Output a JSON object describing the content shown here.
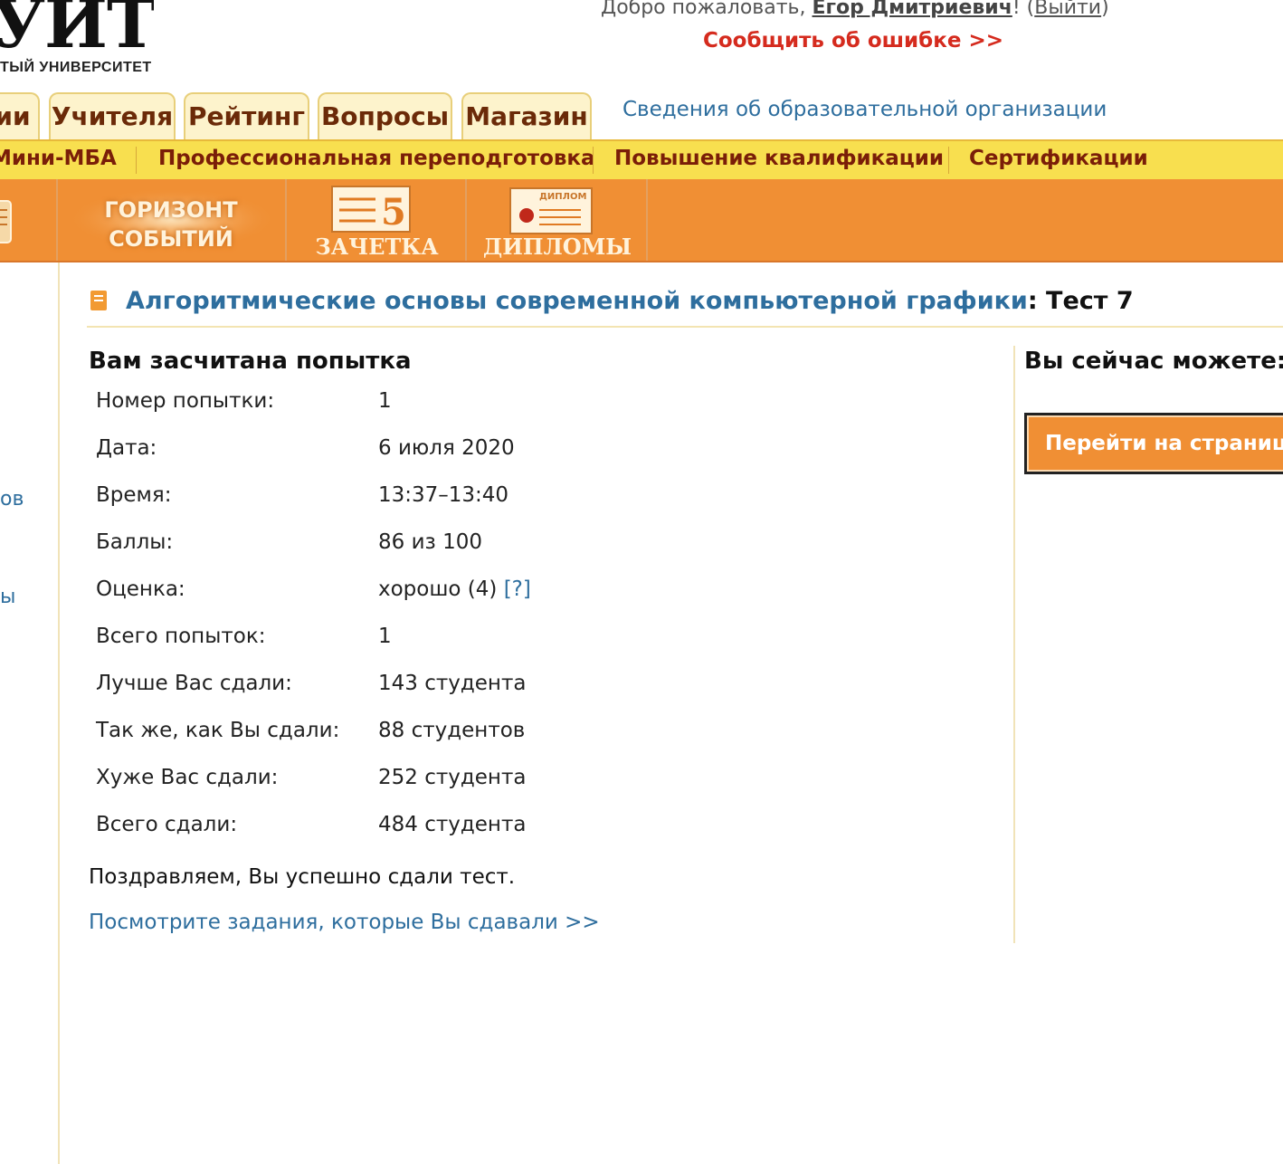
{
  "logo": {
    "big": "УИТ",
    "small": "ТЫЙ УНИВЕРСИТЕТ"
  },
  "header": {
    "welcome_prefix": "Добро пожаловать, ",
    "user_name": "Егор Дмитриевич",
    "welcome_suffix": "! (",
    "logout_label": "Выйти",
    "logout_close": ")",
    "report_error": "Сообщить об ошибке >>"
  },
  "tabs": [
    {
      "label": "ии"
    },
    {
      "label": "Учителя"
    },
    {
      "label": "Рейтинг"
    },
    {
      "label": "Вопросы"
    },
    {
      "label": "Магазин"
    }
  ],
  "org_info_link": "Сведения об образовательной организации",
  "program_bar": [
    {
      "label": "Мини-МБА"
    },
    {
      "label": "Профессиональная переподготовка"
    },
    {
      "label": "Повышение квалификации"
    },
    {
      "label": "Сертификации"
    }
  ],
  "banner": {
    "horizon_line1": "ГОРИЗОНТ",
    "horizon_line2": "СОБЫТИЙ",
    "gradebook_number": "5",
    "gradebook_label": "ЗАЧЕТКА",
    "diploma_tag": "ДИПЛОМ",
    "diplomas_label": "ДИПЛОМЫ"
  },
  "sidebar_fragments": [
    "ов",
    "ы"
  ],
  "page_title": {
    "course": "Алгоритмические основы современной компьютерной графики",
    "suffix": ": Тест 7"
  },
  "attempt": {
    "heading": "Вам засчитана попытка",
    "rows": [
      {
        "label": "Номер попытки:",
        "value": "1"
      },
      {
        "label": "Дата:",
        "value": "6 июля 2020"
      },
      {
        "label": "Время:",
        "value": "13:37–13:40"
      },
      {
        "label": "Баллы:",
        "value": "86 из 100"
      },
      {
        "label": "Оценка:",
        "value": "хорошо (4)",
        "help": "[?]"
      },
      {
        "label": "Всего попыток:",
        "value": "1"
      },
      {
        "label": "Лучше Вас сдали:",
        "value": "143 студента"
      },
      {
        "label": "Так же, как Вы сдали:",
        "value": "88 студентов"
      },
      {
        "label": "Хуже Вас сдали:",
        "value": "252 студента"
      },
      {
        "label": "Всего сдали:",
        "value": "484 студента"
      }
    ],
    "congrats": "Поздравляем, Вы успешно сдали тест.",
    "view_tasks_link": "Посмотрите задания, которые Вы сдавали >>"
  },
  "right_panel": {
    "heading": "Вы сейчас можете:",
    "go_button": "Перейти на страницу"
  }
}
